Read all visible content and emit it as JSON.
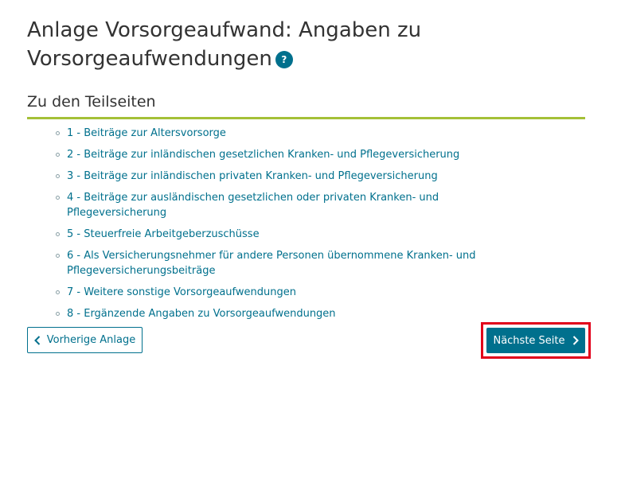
{
  "page": {
    "title": "Anlage Vorsorgeaufwand: Angaben zu Vorsorgeaufwendungen",
    "help_icon": "question-mark-icon",
    "help_glyph": "?"
  },
  "section": {
    "heading": "Zu den Teilseiten"
  },
  "subpages": [
    {
      "label": "1 - Beiträge zur Altersvorsorge"
    },
    {
      "label": "2 - Beiträge zur inländischen gesetzlichen Kranken- und Pflegeversicherung"
    },
    {
      "label": "3 - Beiträge zur inländischen privaten Kranken- und Pflegeversicherung"
    },
    {
      "label": "4 - Beiträge zur ausländischen gesetzlichen oder privaten Kranken- und Pflegeversicherung"
    },
    {
      "label": "5 - Steuerfreie Arbeitgeberzuschüsse"
    },
    {
      "label": "6 - Als Versicherungsnehmer für andere Personen übernommene Kranken- und Pflegeversicherungsbeiträge"
    },
    {
      "label": "7 - Weitere sonstige Vorsorgeaufwendungen"
    },
    {
      "label": "8 - Ergänzende Angaben zu Vorsorgeaufwendungen"
    }
  ],
  "navigation": {
    "prev_label": "Vorherige Anlage",
    "prev_icon": "chevron-left-icon",
    "next_label": "Nächste Seite",
    "next_icon": "chevron-right-icon"
  },
  "colors": {
    "accent": "#00708d",
    "section_underline": "#a4c037",
    "highlight_frame": "#e2001a",
    "text": "#333333"
  }
}
